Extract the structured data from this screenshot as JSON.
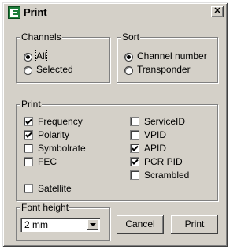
{
  "window": {
    "title": "Print",
    "close_label": "✕"
  },
  "channels": {
    "label": "Channels",
    "options": [
      {
        "label": "All",
        "checked": true
      },
      {
        "label": "Selected",
        "checked": false
      }
    ]
  },
  "sort": {
    "label": "Sort",
    "options": [
      {
        "label": "Channel number",
        "checked": true
      },
      {
        "label": "Transponder",
        "checked": false
      }
    ]
  },
  "print_group": {
    "label": "Print",
    "left": [
      {
        "label": "Frequency",
        "checked": true
      },
      {
        "label": "Polarity",
        "checked": true
      },
      {
        "label": "Symbolrate",
        "checked": false
      },
      {
        "label": "FEC",
        "checked": false
      },
      {
        "label": "Satellite",
        "checked": false
      }
    ],
    "right": [
      {
        "label": "ServiceID",
        "checked": false
      },
      {
        "label": "VPID",
        "checked": false
      },
      {
        "label": "APID",
        "checked": true
      },
      {
        "label": "PCR PID",
        "checked": true
      },
      {
        "label": "Scrambled",
        "checked": false
      }
    ]
  },
  "font_height": {
    "label": "Font height",
    "value": "2 mm"
  },
  "buttons": {
    "cancel": "Cancel",
    "print": "Print"
  }
}
